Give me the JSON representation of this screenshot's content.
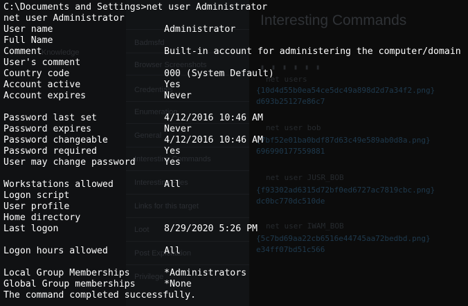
{
  "background_page": {
    "heading": "Interesting Commands",
    "nav_items": [
      "Badmsfd",
      "Browser Screenshots",
      "Credentials",
      "Enumeration",
      "General",
      "Interesting Commands",
      "Interesting Files",
      "Links for this target",
      "Loot",
      "Post Exploitation",
      "Privilege"
    ],
    "side_items": [
      "Knowledge"
    ],
    "commands": [
      "net users",
      "net user bob",
      "net user JUSR_BOB",
      "net user IWAM_BOB"
    ],
    "hashes": [
      "{10d4d55b0ea54ce5dc49a898d2d7a34f2.png}",
      "d693b25127e86c7",
      "{7bf52e01ba0bdf87d63c49e589ab0d8a.png}",
      "696990177559881",
      "{f93302ad6315d72bf0ed6727ac7819cbc.png}",
      "dc0bc770dc510de",
      "{5c7bd69aa22cb6516e44745aa72bedbd.png}",
      "e34ff07bd51c566"
    ]
  },
  "terminal": {
    "prompt_line": "C:\\Documents and Settings>net user Administrator",
    "echo_line": "net user Administrator",
    "fields": [
      {
        "key": "User name",
        "value": "Administrator"
      },
      {
        "key": "Full Name",
        "value": ""
      },
      {
        "key": "Comment",
        "value": "Built-in account for administering the computer/domain"
      },
      {
        "key": "User's comment",
        "value": ""
      },
      {
        "key": "Country code",
        "value": "000 (System Default)"
      },
      {
        "key": "Account active",
        "value": "Yes"
      },
      {
        "key": "Account expires",
        "value": "Never"
      },
      {
        "key": "",
        "value": ""
      },
      {
        "key": "Password last set",
        "value": "4/12/2016 10:46 AM"
      },
      {
        "key": "Password expires",
        "value": "Never"
      },
      {
        "key": "Password changeable",
        "value": "4/12/2016 10:46 AM"
      },
      {
        "key": "Password required",
        "value": "Yes"
      },
      {
        "key": "User may change password",
        "value": "Yes"
      },
      {
        "key": "",
        "value": ""
      },
      {
        "key": "Workstations allowed",
        "value": "All"
      },
      {
        "key": "Logon script",
        "value": ""
      },
      {
        "key": "User profile",
        "value": ""
      },
      {
        "key": "Home directory",
        "value": ""
      },
      {
        "key": "Last logon",
        "value": "8/29/2020 5:26 PM"
      },
      {
        "key": "",
        "value": ""
      },
      {
        "key": "Logon hours allowed",
        "value": "All"
      },
      {
        "key": "",
        "value": ""
      },
      {
        "key": "Local Group Memberships",
        "value": "*Administrators"
      },
      {
        "key": "Global Group memberships",
        "value": "*None"
      }
    ],
    "completion_line": "The command completed successfully."
  }
}
